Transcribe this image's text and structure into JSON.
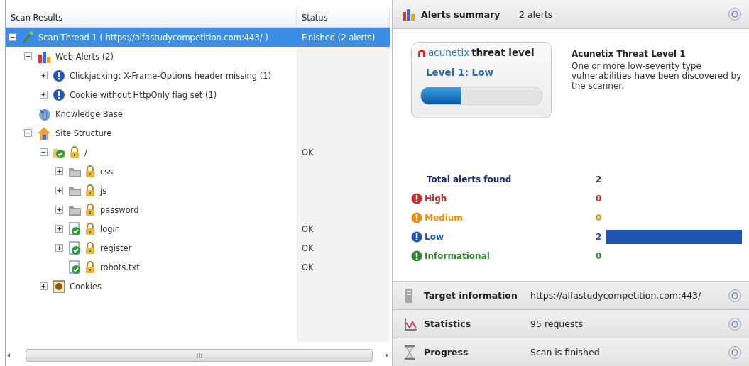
{
  "scan_results": {
    "columns": [
      "Scan Results",
      "Status"
    ],
    "tree": [
      {
        "label": "Scan Thread 1 ( https://alfastudycompetition.com:443/ )",
        "status": "Finished (2 alerts)",
        "kind": "thread",
        "expanded": true,
        "selected": true,
        "children": [
          {
            "label": "Web Alerts (2)",
            "kind": "web-alerts",
            "expanded": true,
            "selected": false,
            "children": [
              {
                "label": "Clickjacking: X-Frame-Options header missing (1)",
                "kind": "alert-low",
                "expanded": false,
                "selected": false
              },
              {
                "label": "Cookie without HttpOnly flag set (1)",
                "kind": "alert-low",
                "expanded": false,
                "selected": false
              }
            ]
          },
          {
            "label": "Knowledge Base",
            "kind": "knowledge",
            "selected": false
          },
          {
            "label": "Site Structure",
            "kind": "site",
            "expanded": true,
            "selected": false,
            "children": [
              {
                "label": "/",
                "status": "OK",
                "kind": "folder-ok",
                "secure": true,
                "expanded": true,
                "selected": false,
                "children": [
                  {
                    "label": "css",
                    "kind": "folder",
                    "secure": true,
                    "expanded": false,
                    "selected": false
                  },
                  {
                    "label": "js",
                    "kind": "folder",
                    "secure": true,
                    "expanded": false,
                    "selected": false
                  },
                  {
                    "label": "password",
                    "kind": "folder",
                    "secure": true,
                    "expanded": false,
                    "selected": false
                  },
                  {
                    "label": "login",
                    "status": "OK",
                    "kind": "file-ok",
                    "secure": true,
                    "expanded": false,
                    "selected": false
                  },
                  {
                    "label": "register",
                    "status": "OK",
                    "kind": "file-ok",
                    "secure": true,
                    "expanded": false,
                    "selected": false
                  },
                  {
                    "label": "robots.txt",
                    "status": "OK",
                    "kind": "file-ok",
                    "secure": true,
                    "selected": false
                  }
                ]
              },
              {
                "label": "Cookies",
                "kind": "cookies",
                "expanded": false,
                "selected": false
              }
            ]
          }
        ]
      }
    ]
  },
  "alerts_summary": {
    "title": "Alerts summary",
    "value": "2 alerts",
    "threat_card": {
      "brand": "acunetix",
      "title": "threat level",
      "level_text": "Level 1: Low",
      "level": 0.33
    },
    "description": {
      "title": "Acunetix Threat Level 1",
      "text": "One or more low-severity type vulnerabilities have been discovered by the scanner."
    },
    "totals": [
      {
        "label": "Total alerts found",
        "count": "2",
        "kind": "total",
        "color": "#1c2a7a"
      },
      {
        "label": "High",
        "count": "0",
        "kind": "severity",
        "color": "#cc2b2b"
      },
      {
        "label": "Medium",
        "count": "0",
        "kind": "severity",
        "color": "#f08c00"
      },
      {
        "label": "Low",
        "count": "2",
        "kind": "severity-bar",
        "color": "#1f55b0"
      },
      {
        "label": "Informational",
        "count": "0",
        "kind": "severity",
        "color": "#2e8b2e"
      }
    ]
  },
  "sections": [
    {
      "kind": "target",
      "title": "Target information",
      "value": "https://alfastudycompetition.com:443/"
    },
    {
      "kind": "statistics",
      "title": "Statistics",
      "value": "95 requests"
    },
    {
      "kind": "progress",
      "title": "Progress",
      "value": "Scan is finished"
    }
  ]
}
